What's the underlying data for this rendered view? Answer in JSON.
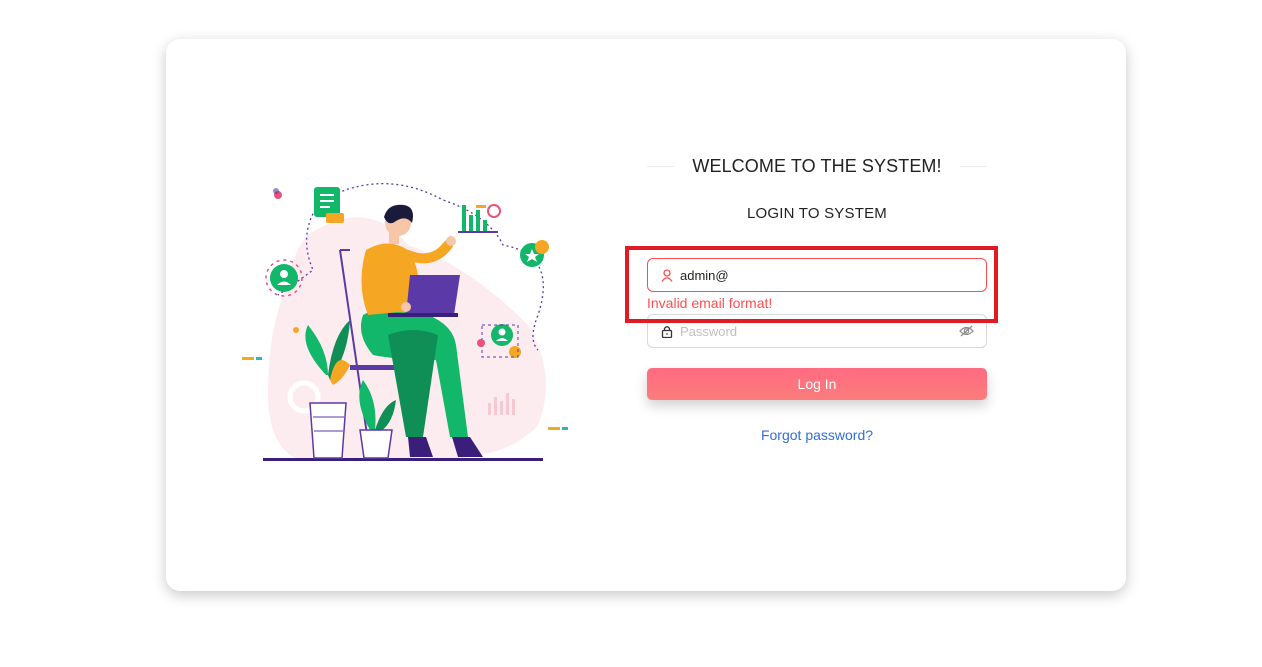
{
  "login": {
    "welcome_title": "WELCOME TO THE SYSTEM!",
    "subtitle": "LOGIN TO SYSTEM",
    "email_value": "admin@",
    "email_error": "Invalid email format!",
    "password_placeholder": "Password",
    "login_button": "Log In",
    "forgot_link": "Forgot password?"
  },
  "colors": {
    "error": "#ff4d4f",
    "highlight_box": "#e01b24",
    "button_gradient_start": "#ff6b81",
    "button_gradient_end": "#fc7c7c",
    "link": "#2f6fdc",
    "illustration_green": "#12b76a",
    "illustration_orange": "#f5a623",
    "illustration_purple": "#5b3aa8"
  },
  "icons": {
    "email_icon": "user-icon",
    "password_icon": "lock-icon",
    "visibility_icon": "eye-off-icon"
  }
}
